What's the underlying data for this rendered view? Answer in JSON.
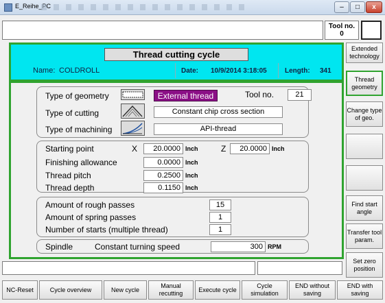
{
  "window": {
    "title": "E_Reihe_PC",
    "min": "–",
    "max": "□",
    "close": "x"
  },
  "tool_header": {
    "label": "Tool no.",
    "value": "0"
  },
  "header": {
    "title": "Thread cutting cycle",
    "name_label": "Name:",
    "name_value": "COLDROLL",
    "date_label": "Date:",
    "date_value": "10/9/2014 3:18:05",
    "length_label": "Length:",
    "length_value": "341"
  },
  "geometry": {
    "type_geometry_label": "Type of geometry",
    "type_geometry_value": "External thread",
    "tool_label": "Tool no.",
    "tool_value": "21",
    "type_cutting_label": "Type of cutting",
    "type_cutting_value": "Constant chip cross section",
    "type_machining_label": "Type of machining",
    "type_machining_value": "API-thread"
  },
  "params": {
    "start_label": "Starting point",
    "x_label": "X",
    "x_value": "20.0000",
    "z_label": "Z",
    "z_value": "20.0000",
    "finish_label": "Finishing allowance",
    "finish_value": "0.0000",
    "pitch_label": "Thread pitch",
    "pitch_value": "0.2500",
    "depth_label": "Thread depth",
    "depth_value": "0.1150",
    "unit": "Inch"
  },
  "passes": {
    "rough_label": "Amount of rough passes",
    "rough_value": "15",
    "spring_label": "Amount of spring passes",
    "spring_value": "1",
    "starts_label": "Number of starts (multiple thread)",
    "starts_value": "1"
  },
  "spindle": {
    "label": "Spindle",
    "mode": "Constant turning speed",
    "value": "300",
    "unit": "RPM"
  },
  "right_buttons": {
    "extended": "Extended technology",
    "thread_geo": "Thread geometry",
    "change_geo": "Change type of geo.",
    "find_angle": "Find start angle",
    "transfer": "Transfer tool param.",
    "set_zero": "Set zero position"
  },
  "bottom_buttons": {
    "nc_reset": "NC-Reset",
    "cycle_overview": "Cycle overview",
    "new_cycle": "New cycle",
    "manual": "Manual recutting",
    "execute": "Execute cycle",
    "simulation": "Cycle simulation",
    "end_nosave": "END without saving",
    "end_save": "END with saving"
  }
}
